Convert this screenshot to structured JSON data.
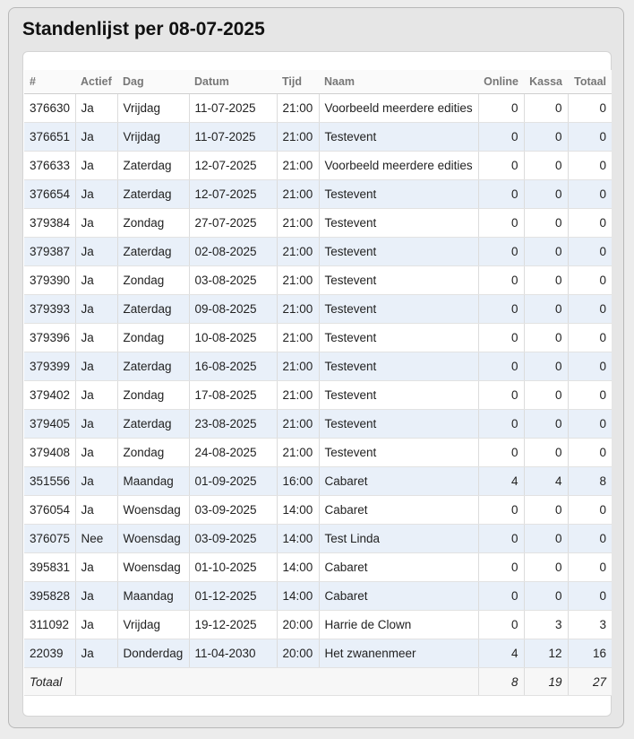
{
  "page": {
    "title": "Standenlijst per 08-07-2025"
  },
  "table": {
    "columns": [
      "#",
      "Actief",
      "Dag",
      "Datum",
      "Tijd",
      "Naam",
      "Online",
      "Kassa",
      "Totaal"
    ],
    "rows": [
      {
        "id": "376630",
        "actief": "Ja",
        "dag": "Vrijdag",
        "datum": "11-07-2025",
        "tijd": "21:00",
        "naam": "Voorbeeld meerdere edities",
        "online": "0",
        "kassa": "0",
        "totaal": "0"
      },
      {
        "id": "376651",
        "actief": "Ja",
        "dag": "Vrijdag",
        "datum": "11-07-2025",
        "tijd": "21:00",
        "naam": "Testevent",
        "online": "0",
        "kassa": "0",
        "totaal": "0"
      },
      {
        "id": "376633",
        "actief": "Ja",
        "dag": "Zaterdag",
        "datum": "12-07-2025",
        "tijd": "21:00",
        "naam": "Voorbeeld meerdere edities",
        "online": "0",
        "kassa": "0",
        "totaal": "0"
      },
      {
        "id": "376654",
        "actief": "Ja",
        "dag": "Zaterdag",
        "datum": "12-07-2025",
        "tijd": "21:00",
        "naam": "Testevent",
        "online": "0",
        "kassa": "0",
        "totaal": "0"
      },
      {
        "id": "379384",
        "actief": "Ja",
        "dag": "Zondag",
        "datum": "27-07-2025",
        "tijd": "21:00",
        "naam": "Testevent",
        "online": "0",
        "kassa": "0",
        "totaal": "0"
      },
      {
        "id": "379387",
        "actief": "Ja",
        "dag": "Zaterdag",
        "datum": "02-08-2025",
        "tijd": "21:00",
        "naam": "Testevent",
        "online": "0",
        "kassa": "0",
        "totaal": "0"
      },
      {
        "id": "379390",
        "actief": "Ja",
        "dag": "Zondag",
        "datum": "03-08-2025",
        "tijd": "21:00",
        "naam": "Testevent",
        "online": "0",
        "kassa": "0",
        "totaal": "0"
      },
      {
        "id": "379393",
        "actief": "Ja",
        "dag": "Zaterdag",
        "datum": "09-08-2025",
        "tijd": "21:00",
        "naam": "Testevent",
        "online": "0",
        "kassa": "0",
        "totaal": "0"
      },
      {
        "id": "379396",
        "actief": "Ja",
        "dag": "Zondag",
        "datum": "10-08-2025",
        "tijd": "21:00",
        "naam": "Testevent",
        "online": "0",
        "kassa": "0",
        "totaal": "0"
      },
      {
        "id": "379399",
        "actief": "Ja",
        "dag": "Zaterdag",
        "datum": "16-08-2025",
        "tijd": "21:00",
        "naam": "Testevent",
        "online": "0",
        "kassa": "0",
        "totaal": "0"
      },
      {
        "id": "379402",
        "actief": "Ja",
        "dag": "Zondag",
        "datum": "17-08-2025",
        "tijd": "21:00",
        "naam": "Testevent",
        "online": "0",
        "kassa": "0",
        "totaal": "0"
      },
      {
        "id": "379405",
        "actief": "Ja",
        "dag": "Zaterdag",
        "datum": "23-08-2025",
        "tijd": "21:00",
        "naam": "Testevent",
        "online": "0",
        "kassa": "0",
        "totaal": "0"
      },
      {
        "id": "379408",
        "actief": "Ja",
        "dag": "Zondag",
        "datum": "24-08-2025",
        "tijd": "21:00",
        "naam": "Testevent",
        "online": "0",
        "kassa": "0",
        "totaal": "0"
      },
      {
        "id": "351556",
        "actief": "Ja",
        "dag": "Maandag",
        "datum": "01-09-2025",
        "tijd": "16:00",
        "naam": "Cabaret",
        "online": "4",
        "kassa": "4",
        "totaal": "8"
      },
      {
        "id": "376054",
        "actief": "Ja",
        "dag": "Woensdag",
        "datum": "03-09-2025",
        "tijd": "14:00",
        "naam": "Cabaret",
        "online": "0",
        "kassa": "0",
        "totaal": "0"
      },
      {
        "id": "376075",
        "actief": "Nee",
        "dag": "Woensdag",
        "datum": "03-09-2025",
        "tijd": "14:00",
        "naam": "Test Linda",
        "online": "0",
        "kassa": "0",
        "totaal": "0"
      },
      {
        "id": "395831",
        "actief": "Ja",
        "dag": "Woensdag",
        "datum": "01-10-2025",
        "tijd": "14:00",
        "naam": "Cabaret",
        "online": "0",
        "kassa": "0",
        "totaal": "0"
      },
      {
        "id": "395828",
        "actief": "Ja",
        "dag": "Maandag",
        "datum": "01-12-2025",
        "tijd": "14:00",
        "naam": "Cabaret",
        "online": "0",
        "kassa": "0",
        "totaal": "0"
      },
      {
        "id": "311092",
        "actief": "Ja",
        "dag": "Vrijdag",
        "datum": "19-12-2025",
        "tijd": "20:00",
        "naam": "Harrie de Clown",
        "online": "0",
        "kassa": "3",
        "totaal": "3"
      },
      {
        "id": "22039",
        "actief": "Ja",
        "dag": "Donderdag",
        "datum": "11-04-2030",
        "tijd": "20:00",
        "naam": "Het zwanenmeer",
        "online": "4",
        "kassa": "12",
        "totaal": "16"
      }
    ],
    "footer": {
      "label": "Totaal",
      "online": "8",
      "kassa": "19",
      "totaal": "27"
    }
  }
}
